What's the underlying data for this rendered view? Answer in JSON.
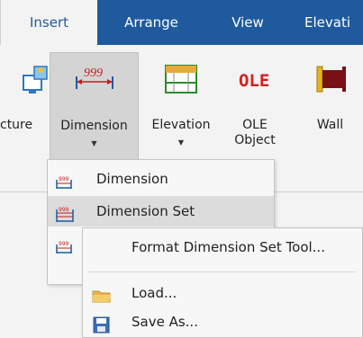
{
  "tabs": [
    {
      "label": "Insert",
      "active": true
    },
    {
      "label": "Arrange"
    },
    {
      "label": "View"
    },
    {
      "label": "Elevati"
    }
  ],
  "ribbon": {
    "buttons": [
      {
        "label": "cture",
        "icon": "picture-icon"
      },
      {
        "label": "Dimension",
        "icon": "dimension-999-icon",
        "pressed": true,
        "dropdown": true
      },
      {
        "label": "Elevation",
        "icon": "elevation-icon",
        "dropdown": true
      },
      {
        "label": "OLE\nObject",
        "icon": "ole-icon",
        "icon_text": "OLE"
      },
      {
        "label": "Wall",
        "icon": "wall-icon"
      }
    ],
    "dimension_icon_text": "999"
  },
  "dimension_menu": {
    "items": [
      {
        "label": "Dimension",
        "icon": "dimension-item-icon"
      },
      {
        "label": "Dimension Set",
        "icon": "dimension-set-icon",
        "highlighted": true
      },
      {
        "label": "",
        "icon": "format-dimension-icon"
      }
    ]
  },
  "submenu": {
    "items": [
      {
        "label": "Format Dimension Set Tool..."
      },
      {
        "label": "Load...",
        "icon": "folder-icon"
      },
      {
        "label": "Save As...",
        "icon": "save-icon"
      }
    ]
  },
  "colors": {
    "tab_bar": "#1f5a9e",
    "ribbon_bg": "#f3f3f3",
    "pressed_bg": "#d4d4d4",
    "highlight_bg": "#dcdcdc",
    "ole_red": "#d31f1f"
  }
}
